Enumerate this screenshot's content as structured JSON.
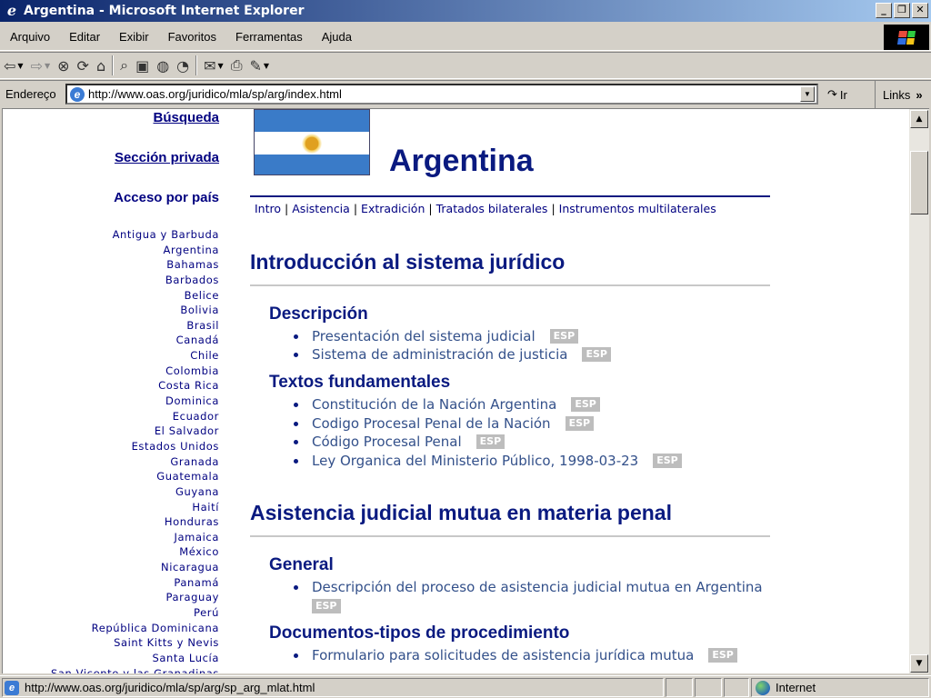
{
  "window": {
    "title": "Argentina - Microsoft Internet Explorer",
    "buttons": [
      "_",
      "❐",
      "✕"
    ]
  },
  "menu": [
    "Arquivo",
    "Editar",
    "Exibir",
    "Favoritos",
    "Ferramentas",
    "Ajuda"
  ],
  "address": {
    "label": "Endereço",
    "url": "http://www.oas.org/juridico/mla/sp/arg/index.html",
    "go": "Ir",
    "links": "Links"
  },
  "status": {
    "text": "http://www.oas.org/juridico/mla/sp/arg/sp_arg_mlat.html",
    "zone": "Internet"
  },
  "sidebar": {
    "search": "Búsqueda",
    "private": "Sección privada",
    "access": "Acceso por país",
    "countries": [
      "Antigua y Barbuda",
      "Argentina",
      "Bahamas",
      "Barbados",
      "Belice",
      "Bolivia",
      "Brasil",
      "Canadá",
      "Chile",
      "Colombia",
      "Costa Rica",
      "Dominica",
      "Ecuador",
      "El Salvador",
      "Estados Unidos",
      "Granada",
      "Guatemala",
      "Guyana",
      "Haití",
      "Honduras",
      "Jamaica",
      "México",
      "Nicaragua",
      "Panamá",
      "Paraguay",
      "Perú",
      "República Dominicana",
      "Saint Kitts y Nevis",
      "Santa Lucía",
      "San Vicente y las Granadinas"
    ]
  },
  "page": {
    "title": "Argentina",
    "nav": [
      "Intro",
      "Asistencia",
      "Extradición",
      "Tratados bilaterales",
      "Instrumentos multilaterales"
    ],
    "esp": "ESP",
    "section1": {
      "title": "Introducción al sistema jurídico",
      "descripcion": {
        "title": "Descripción",
        "items": [
          "Presentación del sistema judicial",
          "Sistema de administración de justicia"
        ]
      },
      "textos": {
        "title": "Textos fundamentales",
        "items": [
          "Constitución de la Nación Argentina",
          "Codigo Procesal Penal de la Nación",
          "Código Procesal Penal",
          "Ley Organica del Ministerio Público, 1998-03-23"
        ]
      }
    },
    "section2": {
      "title": "Asistencia judicial mutua en materia penal",
      "general": {
        "title": "General",
        "items": [
          "Descripción del proceso de asistencia judicial mutua en Argentina"
        ]
      },
      "documentos": {
        "title": "Documentos-tipos de procedimiento",
        "items": [
          "Formulario para solicitudes de asistencia jurídica mutua"
        ]
      }
    }
  }
}
